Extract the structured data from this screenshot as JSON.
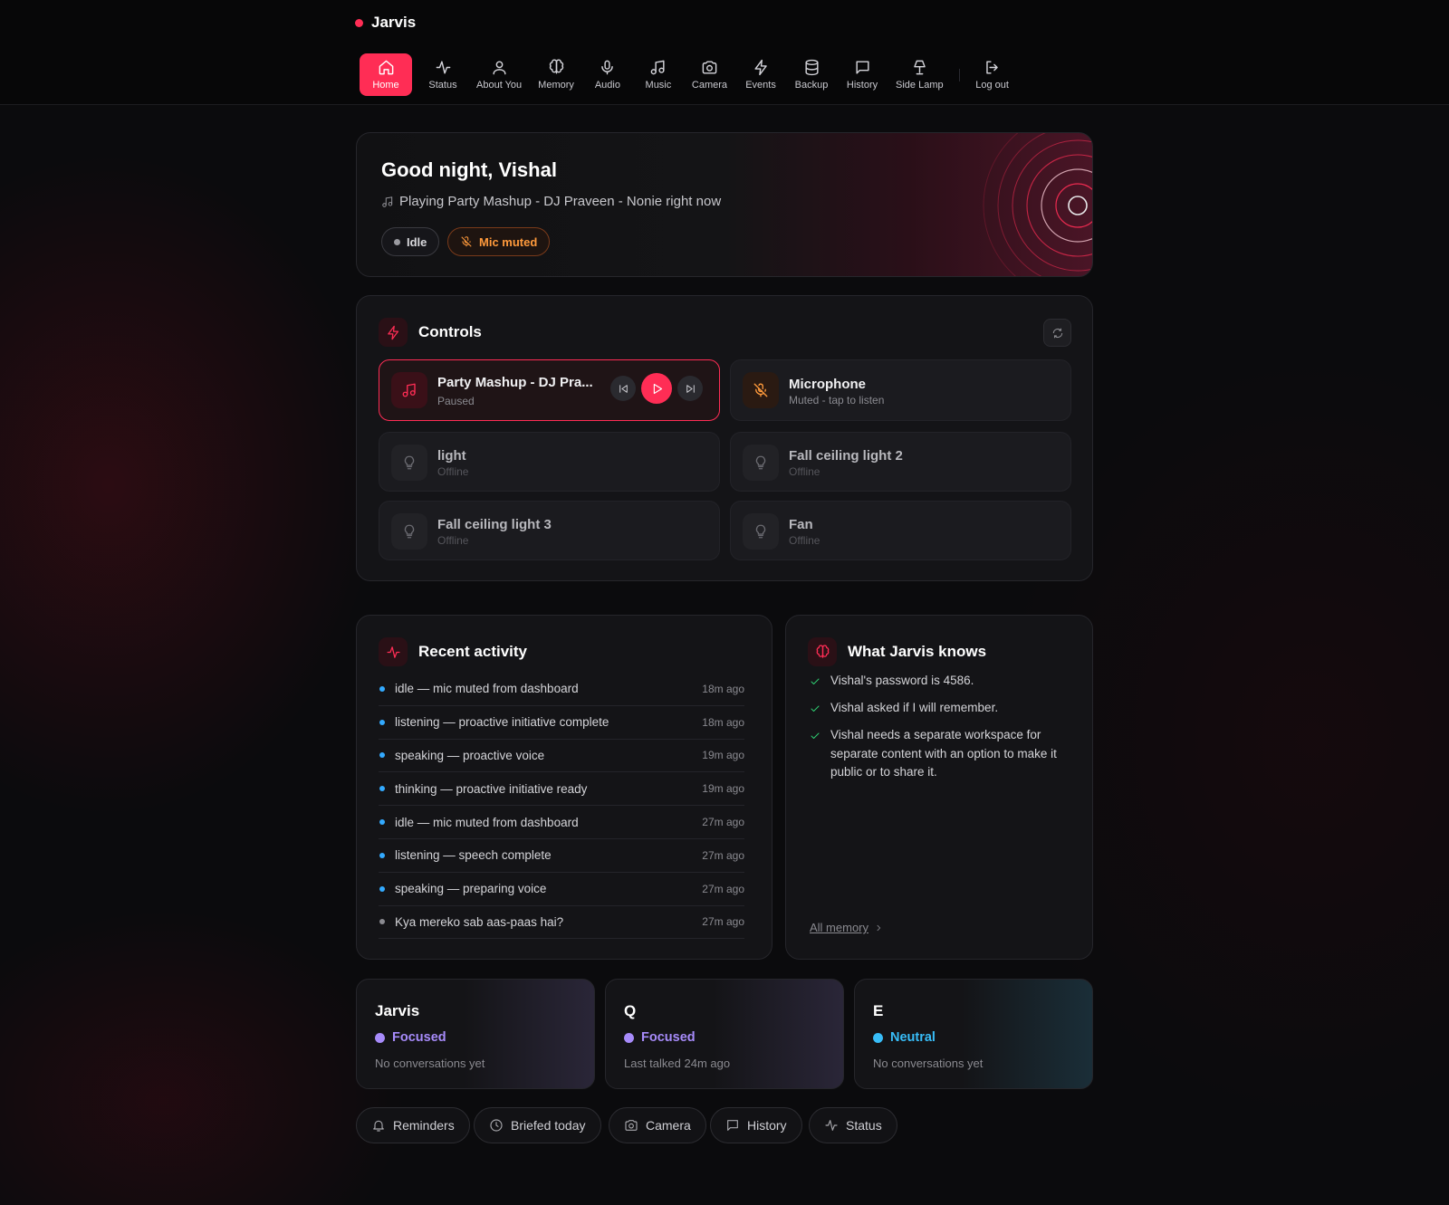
{
  "app": {
    "name": "Jarvis"
  },
  "nav": {
    "items": [
      {
        "label": "Home",
        "icon": "home-icon",
        "active": true
      },
      {
        "label": "Status",
        "icon": "activity-icon"
      },
      {
        "label": "About You",
        "icon": "user-icon"
      },
      {
        "label": "Memory",
        "icon": "brain-icon"
      },
      {
        "label": "Audio",
        "icon": "microphone-icon"
      },
      {
        "label": "Music",
        "icon": "music-note-icon"
      },
      {
        "label": "Camera",
        "icon": "camera-icon"
      },
      {
        "label": "Events",
        "icon": "lightning-icon"
      },
      {
        "label": "Backup",
        "icon": "database-icon"
      },
      {
        "label": "History",
        "icon": "chat-bubble-icon"
      },
      {
        "label": "Side Lamp",
        "icon": "lamp-icon"
      },
      {
        "label": "Log out",
        "icon": "log-out-icon"
      }
    ]
  },
  "hero": {
    "greeting": "Good night, Vishal",
    "now_playing": "Playing Party Mashup - DJ Praveen - Nonie right now",
    "status_pill": "Idle",
    "mic_pill": "Mic muted"
  },
  "controls": {
    "title": "Controls",
    "media": {
      "title": "Party Mashup - DJ Pra...",
      "state": "Paused"
    },
    "microphone": {
      "title": "Microphone",
      "state": "Muted - tap to listen"
    },
    "devices": [
      {
        "name": "light",
        "state": "Offline"
      },
      {
        "name": "Fall ceiling light 2",
        "state": "Offline"
      },
      {
        "name": "Fall ceiling light 3",
        "state": "Offline"
      },
      {
        "name": "Fan",
        "state": "Offline"
      }
    ]
  },
  "activity": {
    "title": "Recent activity",
    "items": [
      {
        "text": "idle — mic muted from dashboard",
        "time": "18m ago"
      },
      {
        "text": "listening — proactive initiative complete",
        "time": "18m ago"
      },
      {
        "text": "speaking — proactive voice",
        "time": "19m ago"
      },
      {
        "text": "thinking — proactive initiative ready",
        "time": "19m ago"
      },
      {
        "text": "idle — mic muted from dashboard",
        "time": "27m ago"
      },
      {
        "text": "listening — speech complete",
        "time": "27m ago"
      },
      {
        "text": "speaking — preparing voice",
        "time": "27m ago"
      },
      {
        "text": "Kya mereko sab aas-paas hai?",
        "time": "27m ago"
      }
    ]
  },
  "knows": {
    "title": "What Jarvis knows",
    "items": [
      "Vishal's password is 4586.",
      "Vishal asked if I will remember.",
      "Vishal needs a separate workspace for separate content with an option to make it public or to share it."
    ],
    "link": "All memory"
  },
  "agents": [
    {
      "name": "Jarvis",
      "mood": "Focused",
      "mood_color": "#a78bfa",
      "sub": "No conversations yet"
    },
    {
      "name": "Q",
      "mood": "Focused",
      "mood_color": "#a78bfa",
      "sub": "Last talked 24m ago"
    },
    {
      "name": "E",
      "mood": "Neutral",
      "mood_color": "#38bdf8",
      "sub": "No conversations yet"
    }
  ],
  "quick_links": [
    {
      "label": "Reminders",
      "icon": "bell-icon"
    },
    {
      "label": "Briefed today",
      "icon": "clock-icon"
    },
    {
      "label": "Camera",
      "icon": "camera-icon"
    },
    {
      "label": "History",
      "icon": "chat-bubble-icon"
    },
    {
      "label": "Status",
      "icon": "activity-icon"
    }
  ],
  "colors": {
    "accent": "#ff2d55",
    "warning": "#ff9a3c",
    "success": "#2ecc71",
    "info": "#33aaff"
  }
}
